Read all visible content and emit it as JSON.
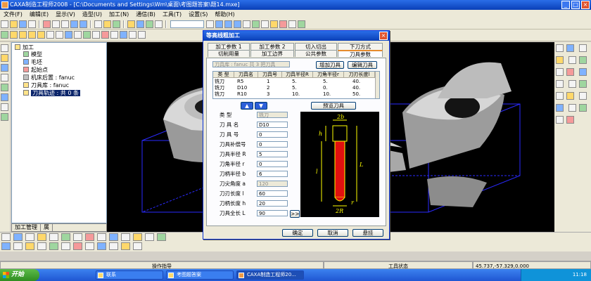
{
  "app": {
    "title": "CAXA制造工程师2008 - [C:\\Documents and Settings\\Wm\\桌面\\考图题答案\\题14.mxe]",
    "window_buttons": [
      "_",
      "□",
      "×"
    ]
  },
  "menu": [
    "文件(F)",
    "编辑(E)",
    "显示(V)",
    "造型(U)",
    "加工(N)",
    "通信(B)",
    "工具(T)",
    "设置(S)",
    "帮助(H)"
  ],
  "tree": {
    "items": [
      {
        "label": "加工",
        "indent": 0
      },
      {
        "label": "模型",
        "indent": 1
      },
      {
        "label": "毛坯",
        "indent": 1
      },
      {
        "label": "起始点",
        "indent": 1
      },
      {
        "label": "机床后置 : fanuc",
        "indent": 1
      },
      {
        "label": "刀具库 : fanuc",
        "indent": 1
      },
      {
        "label": "刀具轨迹 : 共 0 条",
        "indent": 1,
        "selected": true
      }
    ],
    "tabs": [
      "加工管理",
      "属"
    ]
  },
  "dialog": {
    "title": "等高线粗加工",
    "close": "×",
    "tabs_row1": [
      "加工参数 1",
      "加工参数 2",
      "切入切出",
      "下刀方式"
    ],
    "tabs_row2": [
      "切削用量",
      "加工边界",
      "公共参数",
      "刀具参数"
    ],
    "active_tab": "刀具参数",
    "library_label": "刀具库 : fanuc  共 3 把刀具",
    "add_tool": "增加刀具",
    "edit_tool": "编辑刀具",
    "table": {
      "headers": [
        "类 型",
        "刀具名",
        "刀具号",
        "刀具半径R",
        "刀角半径r",
        "刀刃长度l"
      ],
      "rows": [
        [
          "铣刀",
          "R5",
          "1",
          "5.",
          "5.",
          "40."
        ],
        [
          "铣刀",
          "D10",
          "2",
          "5.",
          "0.",
          "40."
        ],
        [
          "铣刀",
          "R10",
          "3",
          "10.",
          "10.",
          "50."
        ]
      ]
    },
    "preview_button": "预览刀具",
    "fields": [
      {
        "label": "类    型",
        "value": "铣刀",
        "disabled": true
      },
      {
        "label": "刀  具  名",
        "value": "D10"
      },
      {
        "label": "刀  具  号",
        "value": "0"
      },
      {
        "label": "刀具补偿号",
        "value": "0"
      },
      {
        "label": "刀具半径 R",
        "value": "5"
      },
      {
        "label": "刀角半径 r",
        "value": "0"
      },
      {
        "label": "刀柄半径 b",
        "value": "6"
      },
      {
        "label": "刀尖角度 a",
        "value": "120",
        "disabled": true
      },
      {
        "label": "刀刃长度 l",
        "value": "60"
      },
      {
        "label": "刀柄长度 h",
        "value": "20"
      },
      {
        "label": "刀具全长 L",
        "value": "90"
      }
    ],
    "more_button": ">>",
    "ok": "确定",
    "cancel": "取消",
    "hang": "悬挂",
    "preview_labels": {
      "top": "2b",
      "h": "h",
      "l": "l",
      "L": "L",
      "R": "2R",
      "r": "r"
    }
  },
  "status": {
    "prompt": "操作指导",
    "tool_state": "工具状态",
    "coords": "45.737,-57.329,0.000"
  },
  "taskbar": {
    "start": "开始",
    "tasks": [
      "联系",
      "考图题答案",
      "CAXA制造工程师20..."
    ],
    "time": "11:18"
  },
  "colors": {
    "viewport_bg": "#000000",
    "bbox_lines": "#2a2aff",
    "tool_red": "#e01010",
    "preview_lines": "#ffff00"
  }
}
